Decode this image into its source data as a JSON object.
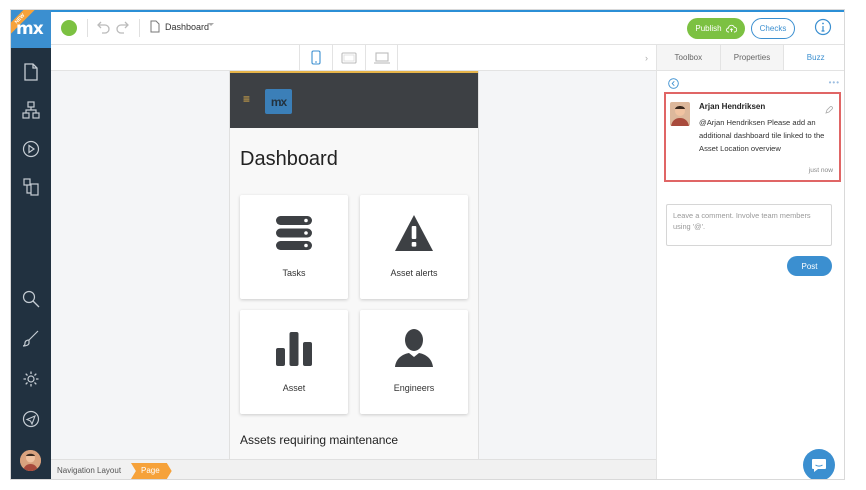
{
  "app": {
    "logo_text": "mx",
    "logo_ribbon": "NEW",
    "document_title": "Dashboard"
  },
  "topbar": {
    "publish_label": "Publish",
    "checks_label": "Checks"
  },
  "phone": {
    "logo_text": "mx",
    "page_title": "Dashboard",
    "tiles": [
      {
        "label": "Tasks",
        "icon": "server-stack-icon"
      },
      {
        "label": "Asset alerts",
        "icon": "warning-icon"
      },
      {
        "label": "Asset",
        "icon": "bar-chart-icon"
      },
      {
        "label": "Engineers",
        "icon": "person-icon"
      }
    ],
    "section_title": "Assets requiring maintenance"
  },
  "breadcrumb": {
    "items": [
      "Navigation Layout",
      "Page"
    ]
  },
  "right_panel": {
    "tabs": [
      "Toolbox",
      "Properties",
      "Buzz"
    ],
    "active_tab": "Buzz",
    "comment": {
      "author": "Arjan Hendriksen",
      "text": "@Arjan Hendriksen Please add an additional dashboard tile linked to the Asset Location overview",
      "time": "just now"
    },
    "input_placeholder": "Leave a comment. Involve team members using '@'.",
    "post_label": "Post"
  },
  "colors": {
    "rail_bg": "#213140",
    "accent_blue": "#3b8fd0",
    "publish_green": "#7cc142",
    "breadcrumb_orange": "#f6a23a",
    "highlight_red": "#e06565"
  }
}
